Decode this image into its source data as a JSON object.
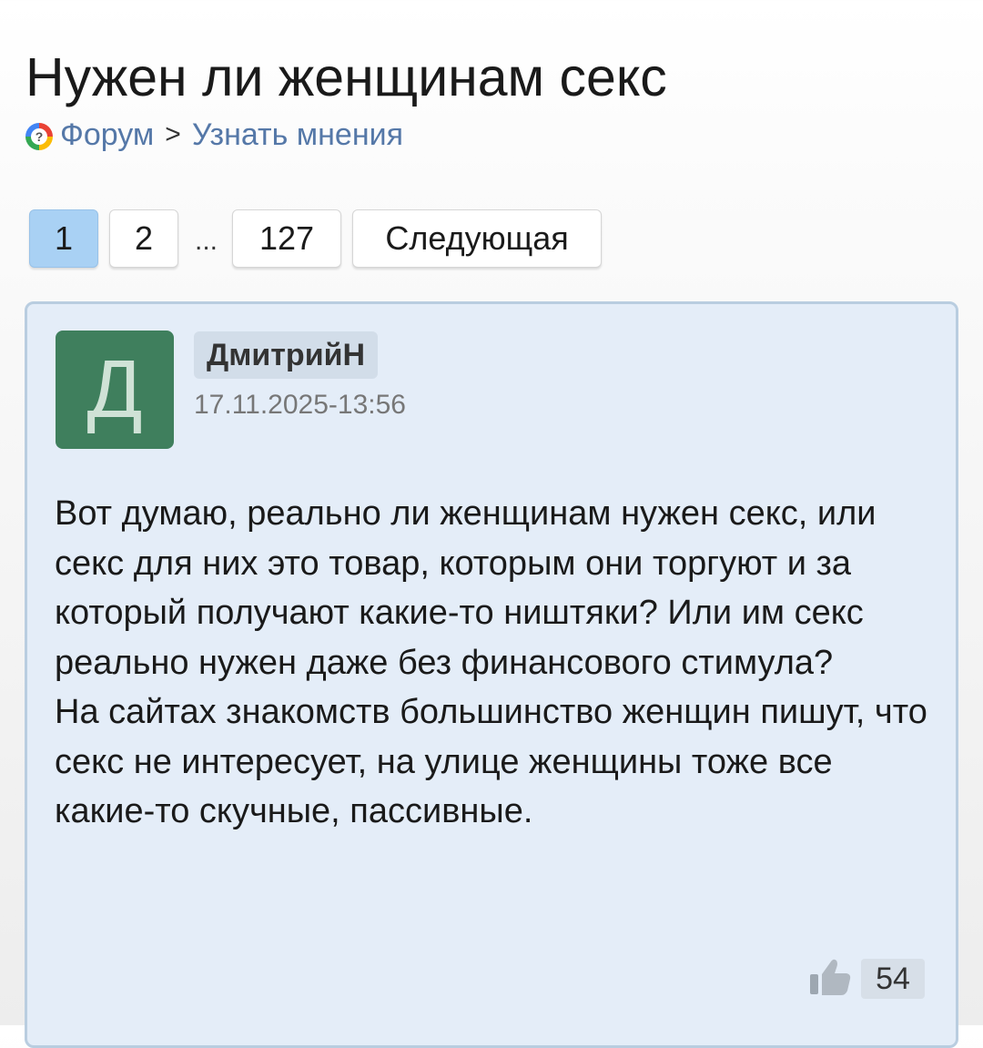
{
  "topic": {
    "title": "Нужен ли женщинам секс"
  },
  "breadcrumb": {
    "icon": "forum-question-icon",
    "forum_label": "Форум",
    "separator": ">",
    "section_label": "Узнать мнения"
  },
  "pagination": {
    "pages": [
      "1",
      "2"
    ],
    "ellipsis": "...",
    "last_page": "127",
    "next_label": "Следующая",
    "active_page": "1"
  },
  "post": {
    "author": "ДмитрийН",
    "avatar_letter": "Д",
    "avatar_color": "#3f7f5d",
    "date": "17.11.2025-13:56",
    "text": "Вот думаю, реально ли женщинам нужен секс, или секс для них это товар, которым они торгуют и за который получают какие-то ништяки? Или им секс реально нужен даже без финансового стимула?\nНа сайтах знакомств большинство женщин пишут, что секс не интересует, на улице женщины тоже все какие-то скучные, пассивные.",
    "likes": "54",
    "like_icon": "thumbs-up-icon"
  },
  "colors": {
    "active_page_bg": "#a9d1f4",
    "post_bg": "#e4edf8",
    "link": "#5578a8"
  }
}
